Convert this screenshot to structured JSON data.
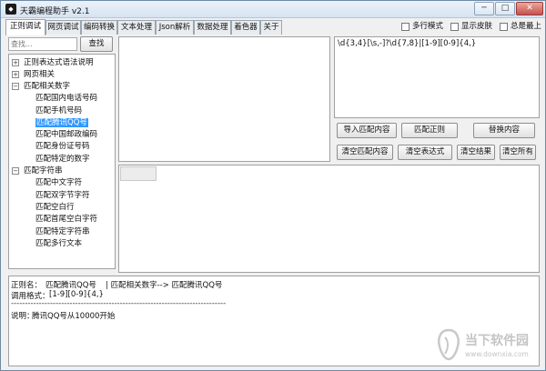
{
  "window": {
    "title": "天霸编程助手 v2.1",
    "min_glyph": "─",
    "max_glyph": "□",
    "close_glyph": "✕"
  },
  "tabs": [
    "正则调试",
    "网页调试",
    "编码转换",
    "文本处理",
    "Json解析",
    "数据处理",
    "着色器",
    "关于"
  ],
  "options": [
    "多行模式",
    "显示皮肤",
    "总是最上"
  ],
  "search": {
    "placeholder": "查找...",
    "button": "查找"
  },
  "tree": {
    "groups": [
      {
        "label": "正则表达式语法说明",
        "expander": "+"
      },
      {
        "label": "网页相关",
        "expander": "+"
      },
      {
        "label": "匹配相关数字",
        "expander": "−",
        "children": [
          "匹配国内电话号码",
          "匹配手机号码",
          "匹配腾讯QQ号",
          "匹配中国邮政编码",
          "匹配身份证号码",
          "匹配特定的数字"
        ]
      },
      {
        "label": "匹配字符串",
        "expander": "−",
        "children": [
          "匹配中文字符",
          "匹配双字节字符",
          "匹配空白行",
          "匹配首尾空白字符",
          "匹配特定字符串",
          "匹配多行文本"
        ]
      }
    ],
    "selected": "匹配腾讯QQ号"
  },
  "regex_input": "\\d{3,4}[\\s,-]?\\d{7,8}|[1-9][0-9]{4,}",
  "buttons": {
    "import": "导入匹配内容",
    "match": "匹配正则",
    "replace": "替换内容",
    "clear_match": "清空匹配内容",
    "clear_expr": "清空表达式",
    "clear_result": "清空结果",
    "clear_all": "清空所有"
  },
  "info": {
    "rule_name_key": "正则名：",
    "rule_name_value": "匹配腾讯QQ号",
    "path": "| 匹配相关数字-->  匹配腾讯QQ号",
    "format_key": "调用格式：",
    "format_value": "[1-9][0-9]{4,}",
    "separator": "-----------------------------------------------------------------------------",
    "desc_key": "说明：",
    "desc_value": "腾讯QQ号从10000开始"
  },
  "watermark": {
    "text": "当下软件园",
    "sub": "www.downxia.com"
  }
}
